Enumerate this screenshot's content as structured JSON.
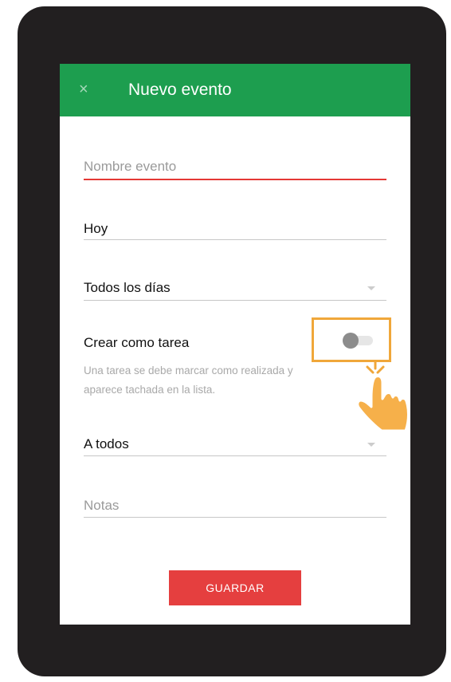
{
  "header": {
    "close_glyph": "×",
    "title": "Nuevo evento"
  },
  "form": {
    "event_name": {
      "placeholder": "Nombre evento"
    },
    "date": {
      "value": "Hoy"
    },
    "repeat": {
      "value": "Todos los días"
    },
    "task": {
      "label": "Crear como tarea",
      "enabled": false,
      "help_line1": "Una tarea se debe marcar como realizada y",
      "help_line2": "aparece tachada en la lista."
    },
    "assignee": {
      "value": "A todos"
    },
    "notes": {
      "placeholder": "Notas"
    },
    "save_label": "GUARDAR"
  },
  "colors": {
    "appbar": "#1d9e4f",
    "accent_red": "#e53935",
    "save_button": "#e53f3f",
    "highlight": "#f0a73a",
    "device_frame": "#221f20"
  },
  "icons": {
    "close": "close-icon",
    "hand": "hand-pointer-icon",
    "dropdown": "chevron-down-icon"
  }
}
